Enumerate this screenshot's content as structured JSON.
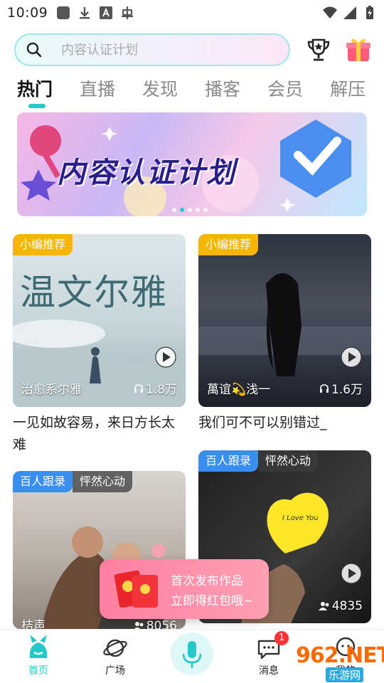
{
  "status_bar": {
    "time": "10:09"
  },
  "search": {
    "placeholder": "内容认证计划"
  },
  "tabs": [
    {
      "label": "热门",
      "active": true
    },
    {
      "label": "直播"
    },
    {
      "label": "发现"
    },
    {
      "label": "播客"
    },
    {
      "label": "会员"
    },
    {
      "label": "解压"
    }
  ],
  "banner": {
    "title": "内容认证计划",
    "page_count": 5,
    "active_index": 1
  },
  "cards": [
    {
      "badge": "小编推荐",
      "badge_color": "#f7b500",
      "image_text": "温文尔雅",
      "author": "治愈系尔雅",
      "count": "1.8万",
      "count_icon": "headphone-icon",
      "caption_line1": "一见如故容易，来日方长太",
      "caption_line2": "难"
    },
    {
      "badge": "小编推荐",
      "badge_color": "#f7b500",
      "author": "萬谊💫浅一",
      "count": "1.6万",
      "count_icon": "headphone-icon",
      "caption_line1": "我们可不可以别错过_"
    },
    {
      "badge": "百人跟录",
      "badge_color": "#3a8ef0",
      "badge2": "怦然心动",
      "author": "桔声",
      "count": "8056",
      "count_icon": "people-icon"
    },
    {
      "badge": "百人跟录",
      "badge_color": "#3a8ef0",
      "badge2": "怦然心动",
      "image_text": "I Love You",
      "count": "4835",
      "count_icon": "people-icon"
    }
  ],
  "promo": {
    "line1": "首次发布作品",
    "line2": "立即得红包哦~"
  },
  "bottom_nav": {
    "home": "首页",
    "square": "广场",
    "messages": "消息",
    "messages_badge": "1",
    "profile": "我的"
  },
  "watermark": {
    "text": "962.NET",
    "sub": "乐游网"
  },
  "colors": {
    "accent": "#23c9c9",
    "badge_yellow": "#f7b500",
    "badge_blue": "#3a8ef0",
    "promo_pink": "#ff8fab"
  }
}
